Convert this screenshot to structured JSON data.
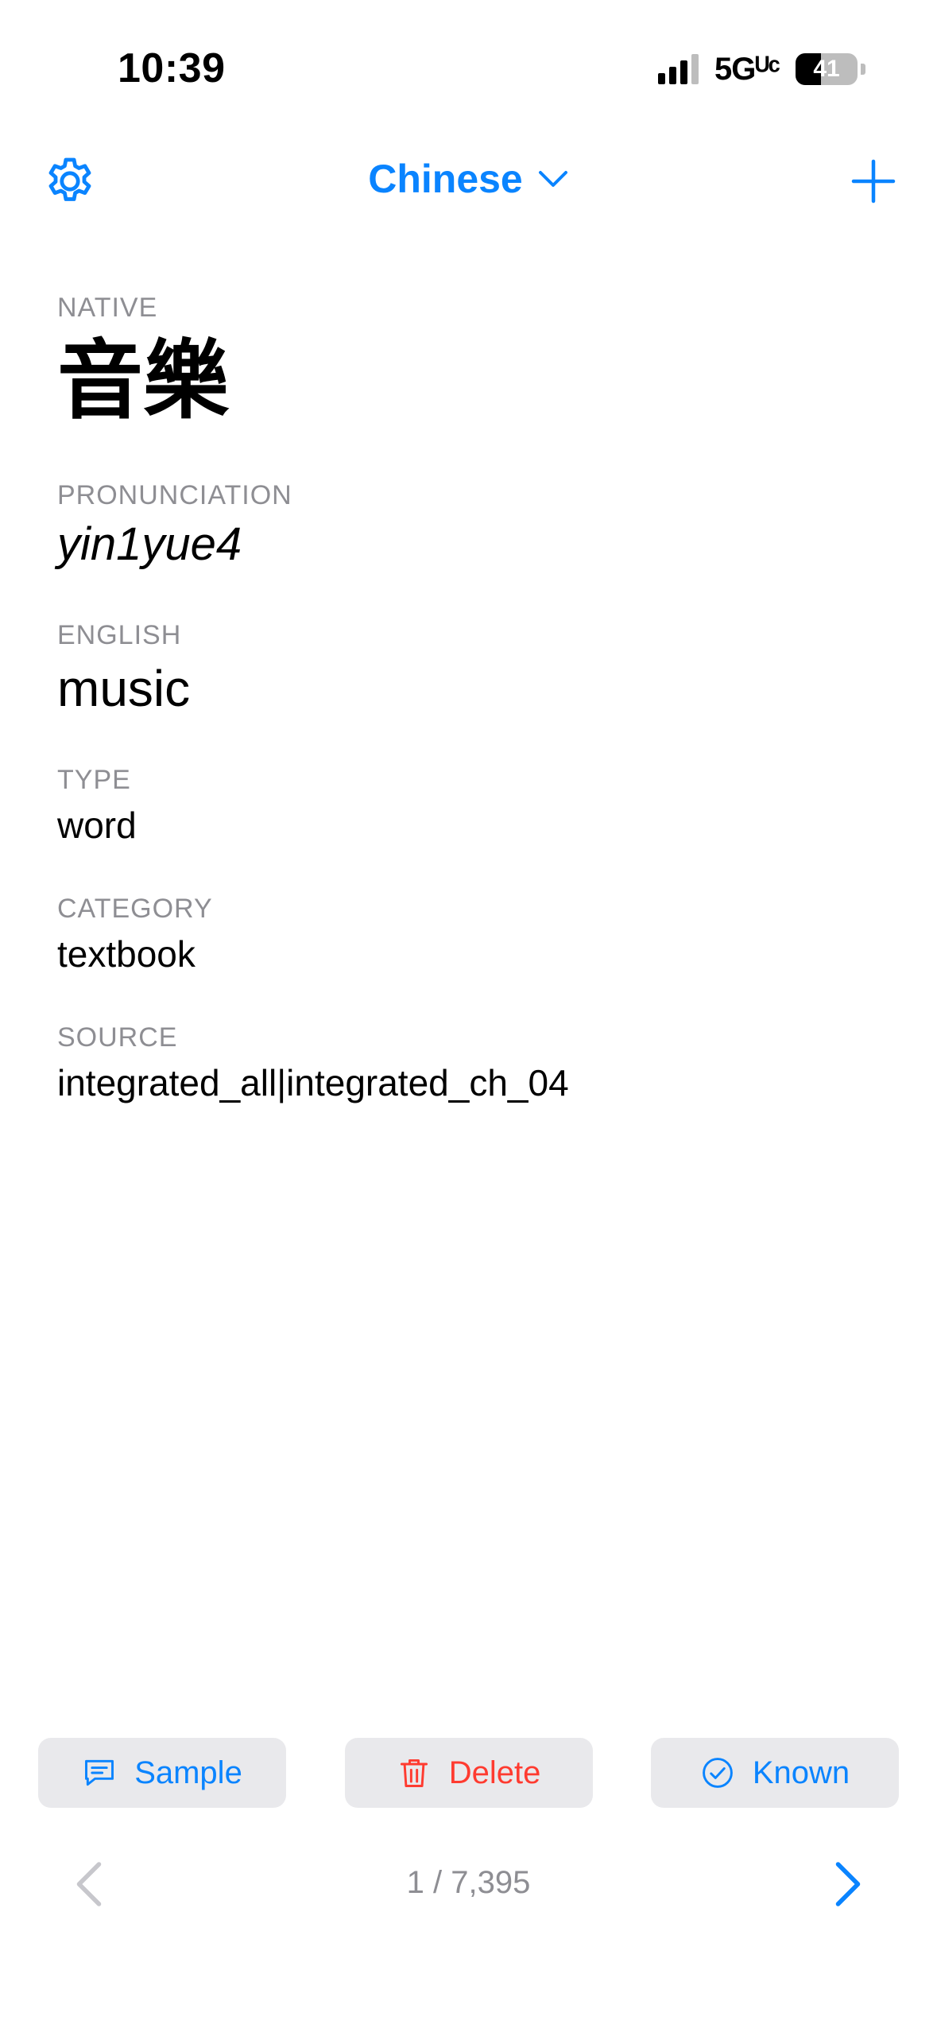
{
  "status_bar": {
    "time": "10:39",
    "network": "5Gᵁᶜ",
    "battery": "41"
  },
  "nav": {
    "title": "Chinese",
    "settings_icon": "gear-icon",
    "add_icon": "plus-icon"
  },
  "fields": {
    "native": {
      "label": "NATIVE",
      "value": "音樂"
    },
    "pronunciation": {
      "label": "PRONUNCIATION",
      "value": "yin1yue4"
    },
    "english": {
      "label": "ENGLISH",
      "value": "music"
    },
    "type": {
      "label": "TYPE",
      "value": "word"
    },
    "category": {
      "label": "CATEGORY",
      "value": "textbook"
    },
    "source": {
      "label": "SOURCE",
      "value": "integrated_all|integrated_ch_04"
    }
  },
  "actions": {
    "sample": "Sample",
    "delete": "Delete",
    "known": "Known"
  },
  "pager": {
    "position": "1 / 7,395"
  },
  "colors": {
    "accent": "#0a84ff",
    "destructive": "#ff3b30",
    "label_gray": "#8e8e93",
    "button_bg": "#e9e9ec"
  }
}
